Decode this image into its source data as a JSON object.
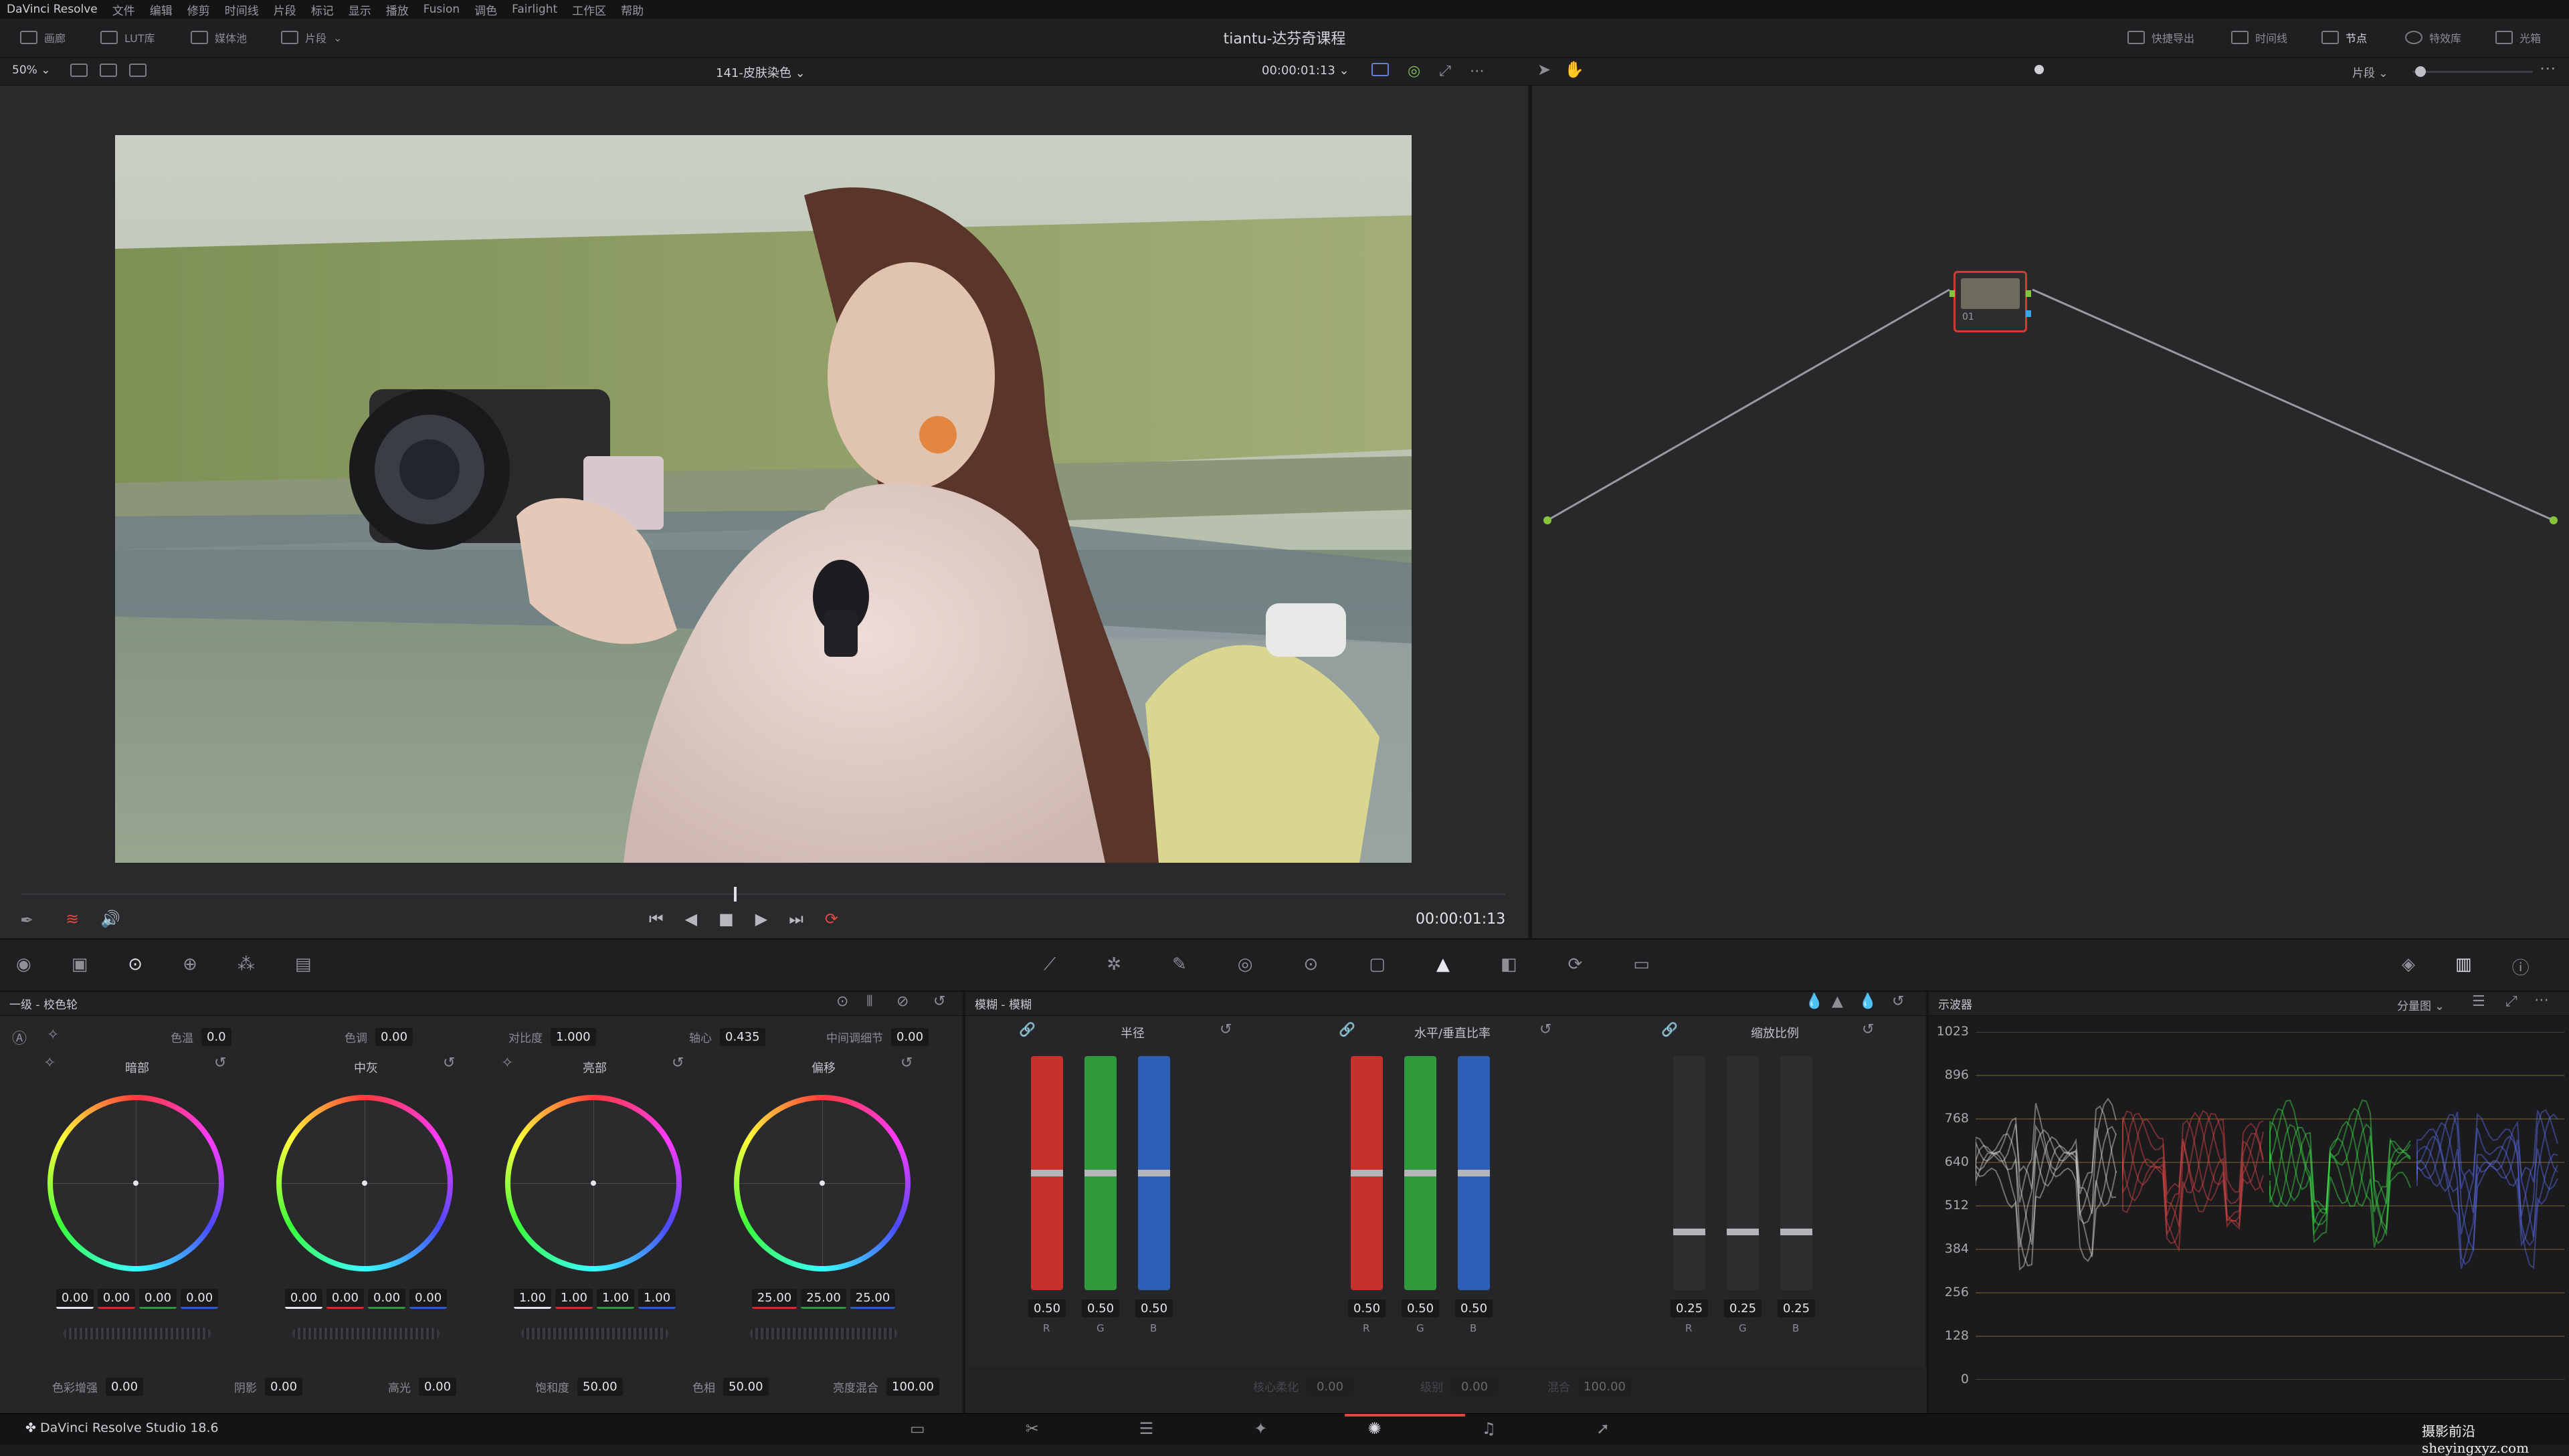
{
  "menu": [
    "DaVinci Resolve",
    "文件",
    "编辑",
    "修剪",
    "时间线",
    "片段",
    "标记",
    "显示",
    "播放",
    "Fusion",
    "调色",
    "Fairlight",
    "工作区",
    "帮助"
  ],
  "toolbar": {
    "left_items": [
      "画廊",
      "LUT库",
      "媒体池",
      "片段"
    ],
    "right_items": [
      "快捷导出",
      "时间线",
      "节点",
      "特效库",
      "光箱"
    ],
    "project_title": "tiantu-达芬奇课程"
  },
  "viewer": {
    "zoom": "50%",
    "clip_name": "141-皮肤染色",
    "timecode_top": "00:00:01:13",
    "timecode": "00:00:01:13",
    "scrub_progress": 0.48
  },
  "node_bar": {
    "mode": "片段"
  },
  "node": {
    "label": "01"
  },
  "colors": {
    "red": "#c8302c",
    "green": "#2f9a3a",
    "blue": "#2e5fb8",
    "accent": "#e3463a"
  },
  "primaries": {
    "title": "一级 - 校色轮",
    "top_params": [
      {
        "label": "色温",
        "value": "0.0"
      },
      {
        "label": "色调",
        "value": "0.00"
      },
      {
        "label": "对比度",
        "value": "1.000"
      },
      {
        "label": "轴心",
        "value": "0.435"
      },
      {
        "label": "中间调细节",
        "value": "0.00"
      }
    ],
    "wheels": [
      {
        "name": "暗部",
        "values": [
          "0.00",
          "0.00",
          "0.00",
          "0.00"
        ]
      },
      {
        "name": "中灰",
        "values": [
          "0.00",
          "0.00",
          "0.00",
          "0.00"
        ]
      },
      {
        "name": "亮部",
        "values": [
          "1.00",
          "1.00",
          "1.00",
          "1.00"
        ]
      },
      {
        "name": "偏移",
        "values": [
          "25.00",
          "25.00",
          "25.00"
        ]
      }
    ],
    "bottom_params": [
      {
        "label": "色彩增强",
        "value": "0.00"
      },
      {
        "label": "阴影",
        "value": "0.00"
      },
      {
        "label": "高光",
        "value": "0.00"
      },
      {
        "label": "饱和度",
        "value": "50.00"
      },
      {
        "label": "色相",
        "value": "50.00"
      },
      {
        "label": "亮度混合",
        "value": "100.00"
      }
    ]
  },
  "blur": {
    "title": "模糊 - 模糊",
    "groups": [
      {
        "name": "半径",
        "values": [
          "0.50",
          "0.50",
          "0.50"
        ],
        "level": 0.5
      },
      {
        "name": "水平/垂直比率",
        "values": [
          "0.50",
          "0.50",
          "0.50"
        ],
        "level": 0.5
      },
      {
        "name": "缩放比例",
        "values": [
          "0.25",
          "0.25",
          "0.25"
        ],
        "level": 0.25
      }
    ],
    "channels": [
      "R",
      "G",
      "B"
    ],
    "bottom_params": [
      {
        "label": "核心柔化",
        "value": "0.00"
      },
      {
        "label": "级别",
        "value": "0.00"
      },
      {
        "label": "混合",
        "value": "100.00"
      }
    ]
  },
  "scope": {
    "title": "示波器",
    "mode": "分量图",
    "scale": [
      "1023",
      "896",
      "768",
      "640",
      "512",
      "384",
      "256",
      "128",
      "0"
    ]
  },
  "footer": {
    "app": "DaVinci Resolve Studio 18.6",
    "watermark": "摄影前沿 sheyingxyz.com"
  }
}
